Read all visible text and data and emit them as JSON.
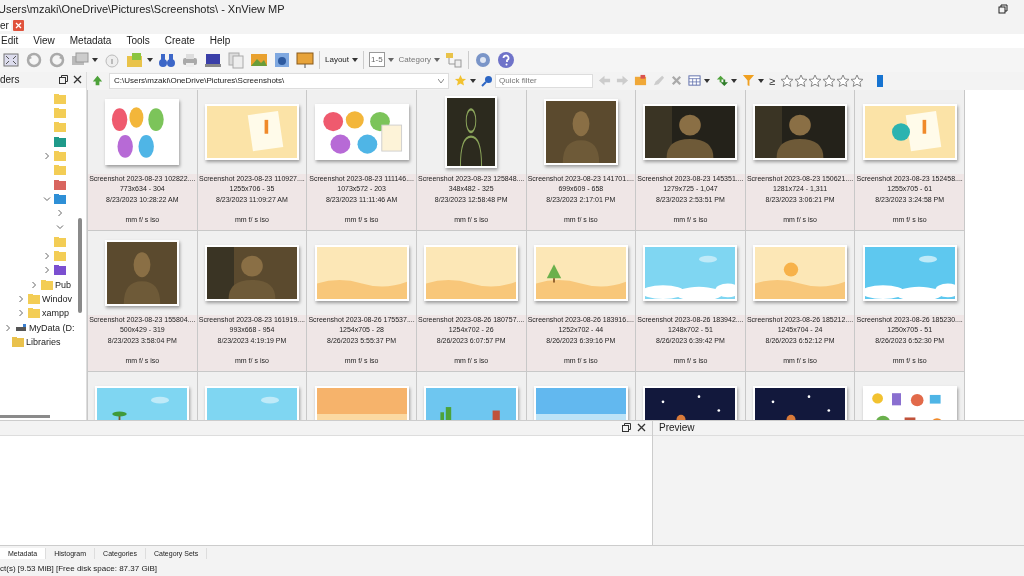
{
  "window": {
    "title": "Users\\mzaki\\OneDrive\\Pictures\\Screenshots\\ - XnView MP"
  },
  "tabs": [
    {
      "label": "er",
      "selected": true
    }
  ],
  "menu": [
    "Edit",
    "View",
    "Metadata",
    "Tools",
    "Create",
    "Help"
  ],
  "toolbar": {
    "layout": "Layout",
    "rating_range": "1-5",
    "category": "Category"
  },
  "folders_panel": {
    "title": "ders",
    "tree": [
      {
        "children": [
          {
            "children": [
              {
                "children": [
                  {
                    "children": [
                      {
                        "kind": "folder"
                      },
                      {
                        "kind": "folder"
                      },
                      {
                        "kind": "folder"
                      },
                      {
                        "kind": "download"
                      },
                      {
                        "kind": "folder",
                        "expanded": false
                      },
                      {
                        "kind": "folder"
                      },
                      {
                        "kind": "music"
                      },
                      {
                        "kind": "special",
                        "expanded": true,
                        "children": [
                          {
                            "expanded": false
                          },
                          {
                            "expanded": true
                          }
                        ]
                      },
                      {
                        "kind": "folder"
                      },
                      {
                        "kind": "folder",
                        "expanded": false
                      },
                      {
                        "kind": "video",
                        "expanded": false
                      }
                    ]
                  },
                  {
                    "kind": "folder",
                    "label": "Pub",
                    "expanded": false
                  }
                ]
              },
              {
                "kind": "folder",
                "label": "Windov",
                "expanded": false
              },
              {
                "kind": "folder",
                "label": "xampp",
                "expanded": false
              }
            ]
          },
          {
            "kind": "drive",
            "label": "MyData (D:",
            "expanded": false
          }
        ]
      },
      {
        "kind": "library",
        "label": "Libraries"
      }
    ]
  },
  "address": {
    "value": "C:\\Users\\mzaki\\OneDrive\\Pictures\\Screenshots\\"
  },
  "filter": {
    "placeholder": "Quick filter",
    "operator": "≥",
    "stars": 0
  },
  "thumbnails": [
    {
      "name": "Screenshot 2023-08-23 102822....",
      "info": "773x634 - 304",
      "date": "8/23/2023 10:28:22 AM",
      "exif": "mm f/ s iso"
    },
    {
      "name": "Screenshot 2023-08-23 110927....",
      "info": "1255x706 - 35",
      "date": "8/23/2023 11:09:27 AM",
      "exif": "mm f/ s iso"
    },
    {
      "name": "Screenshot 2023-08-23 111146....",
      "info": "1073x572 - 203",
      "date": "8/23/2023 11:11:46 AM",
      "exif": "mm f/ s iso"
    },
    {
      "name": "Screenshot 2023-08-23 125848....",
      "info": "348x482 - 325",
      "date": "8/23/2023 12:58:48 PM",
      "exif": "mm f/ s iso"
    },
    {
      "name": "Screenshot 2023-08-23 141701....",
      "info": "699x609 - 658",
      "date": "8/23/2023 2:17:01 PM",
      "exif": "mm f/ s iso"
    },
    {
      "name": "Screenshot 2023-08-23 145351....",
      "info": "1279x725 - 1,047",
      "date": "8/23/2023 2:53:51 PM",
      "exif": "mm f/ s iso"
    },
    {
      "name": "Screenshot 2023-08-23 150621....",
      "info": "1281x724 - 1,311",
      "date": "8/23/2023 3:06:21 PM",
      "exif": "mm f/ s iso"
    },
    {
      "name": "Screenshot 2023-08-23 152458....",
      "info": "1255x705 - 61",
      "date": "8/23/2023 3:24:58 PM",
      "exif": "mm f/ s iso"
    },
    {
      "name": "Screenshot 2023-08-23 155804....",
      "info": "500x429 - 319",
      "date": "8/23/2023 3:58:04 PM",
      "exif": "mm f/ s iso"
    },
    {
      "name": "Screenshot 2023-08-23 161919....",
      "info": "993x668 - 954",
      "date": "8/23/2023 4:19:19 PM",
      "exif": "mm f/ s iso"
    },
    {
      "name": "Screenshot 2023-08-26 175537....",
      "info": "1254x705 - 28",
      "date": "8/26/2023 5:55:37 PM",
      "exif": "mm f/ s iso"
    },
    {
      "name": "Screenshot 2023-08-26 180757....",
      "info": "1254x702 - 26",
      "date": "8/26/2023 6:07:57 PM",
      "exif": "mm f/ s iso"
    },
    {
      "name": "Screenshot 2023-08-26 183916....",
      "info": "1252x702 - 44",
      "date": "8/26/2023 6:39:16 PM",
      "exif": "mm f/ s iso"
    },
    {
      "name": "Screenshot 2023-08-26 183942....",
      "info": "1248x702 - 51",
      "date": "8/26/2023 6:39:42 PM",
      "exif": "mm f/ s iso"
    },
    {
      "name": "Screenshot 2023-08-26 185212....",
      "info": "1245x704 - 24",
      "date": "8/26/2023 6:52:12 PM",
      "exif": "mm f/ s iso"
    },
    {
      "name": "Screenshot 2023-08-26 185230....",
      "info": "1250x705 - 51",
      "date": "8/26/2023 6:52:30 PM",
      "exif": "mm f/ s iso"
    },
    {
      "kind": "picture"
    },
    {
      "kind": "picture"
    },
    {
      "kind": "picture"
    },
    {
      "kind": "picture"
    },
    {
      "kind": "picture"
    },
    {
      "kind": "picture"
    },
    {
      "kind": "picture"
    },
    {
      "kind": "picture"
    }
  ],
  "preview_panel": {
    "title": "Preview"
  },
  "bottom_tabs": [
    {
      "label": "Metadata",
      "selected": true
    },
    {
      "label": "Histogram",
      "selected": false
    },
    {
      "label": "Categories",
      "selected": false
    },
    {
      "label": "Category Sets",
      "selected": false
    }
  ],
  "status_bar": "ct(s) [9.53 MiB] [Free disk space: 87.37 GiB]"
}
